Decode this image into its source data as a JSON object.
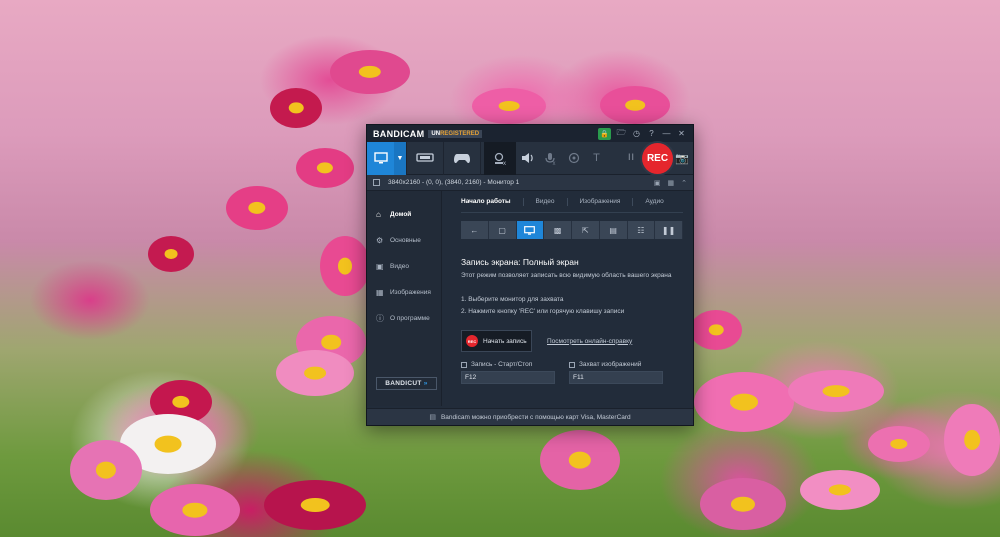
{
  "app": {
    "logo": "BANDICAM",
    "unregistered_prefix": "UN",
    "unregistered_rest": "REGISTERED"
  },
  "titlebar_icons": [
    "lock-icon",
    "folder-icon",
    "clock-icon",
    "help-icon",
    "minimize-icon",
    "close-icon"
  ],
  "toolbar": {
    "rec_label": "REC",
    "pause_label": "II",
    "text_tool": "T"
  },
  "infobar": {
    "target_text": "3840x2160 - (0, 0), (3840, 2160) - Монитор 1"
  },
  "sidebar": {
    "items": [
      {
        "label": "Домой",
        "icon": "home-icon"
      },
      {
        "label": "Основные",
        "icon": "gear-icon"
      },
      {
        "label": "Видео",
        "icon": "video-icon"
      },
      {
        "label": "Изображения",
        "icon": "image-icon"
      },
      {
        "label": "О программе",
        "icon": "info-icon"
      }
    ],
    "bandicut_prefix": "BANDI",
    "bandicut_suffix": "CUT"
  },
  "tabs": [
    {
      "label": "Начало работы"
    },
    {
      "label": "Видео"
    },
    {
      "label": "Изображения"
    },
    {
      "label": "Аудио"
    }
  ],
  "main": {
    "headline": "Запись экрана: Полный экран",
    "description": "Этот режим позволяет записать всю видимую область вашего экрана",
    "step1": "1. Выберите монитор для захвата",
    "step2": "2. Нажмите кнопку 'REC' или горячую клавишу записи",
    "start_button": "Начать запись",
    "rec_dot": "REC",
    "help_link": "Посмотреть онлайн-справку",
    "hotkey_record_label": "Запись - Старт/Стоп",
    "hotkey_record_value": "F12",
    "hotkey_capture_label": "Захват изображений",
    "hotkey_capture_value": "F11"
  },
  "statusbar": {
    "text": "Bandicam можно приобрести с помощью карт Visa, MasterCard"
  },
  "colors": {
    "accent": "#1f86d8",
    "rec": "#e5262d",
    "window_bg": "#222c3a"
  }
}
